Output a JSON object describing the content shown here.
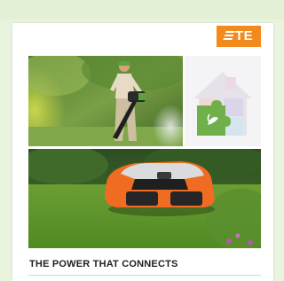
{
  "brand": {
    "logo_text": "TE",
    "logo_color": "#f28a1e"
  },
  "card": {
    "headline": "THE POWER THAT CONNECTS"
  },
  "images": [
    {
      "name": "leaf-blower-photo"
    },
    {
      "name": "puzzle-house-graphic"
    },
    {
      "name": "robotic-mower-photo"
    }
  ],
  "colors": {
    "page_background": "#e9f4df",
    "accent_orange": "#f28a1e",
    "puzzle_green": "#6fb04a"
  }
}
